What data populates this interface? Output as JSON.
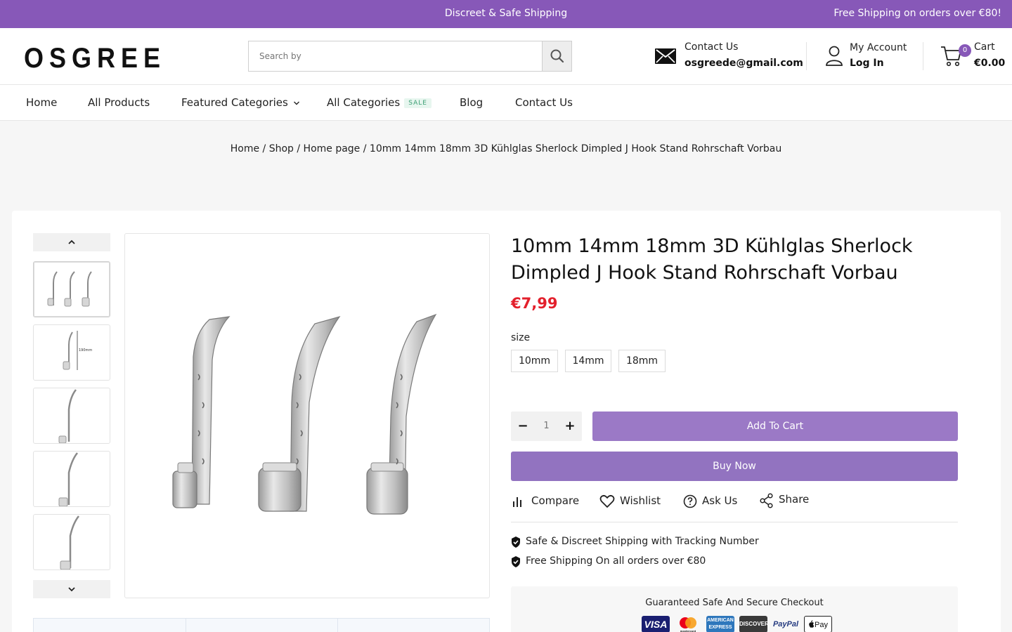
{
  "topbar": {
    "center_text": "Discreet & Safe Shipping",
    "right_text": "Free Shipping on orders over €80!"
  },
  "header": {
    "logo": "OSGREE",
    "search_placeholder": "Search by",
    "contact_label": "Contact Us",
    "contact_email": "osgreede@gmail.com",
    "account_label": "My Account",
    "account_action": "Log In",
    "cart_label": "Cart",
    "cart_total": "€0.00",
    "cart_count": "0"
  },
  "nav": {
    "home": "Home",
    "all_products": "All Products",
    "featured_categories": "Featured Categories",
    "all_categories": "All Categories",
    "sale_badge": "SALE",
    "blog": "Blog",
    "contact_us": "Contact Us"
  },
  "breadcrumb": "Home / Shop / Home page / 10mm 14mm 18mm 3D Kühlglas Sherlock Dimpled J Hook Stand Rohrschaft Vorbau",
  "product": {
    "title": "10mm 14mm 18mm 3D Kühlglas Sherlock Dimpled J Hook Stand Rohrschaft Vorbau",
    "price": "€7,99",
    "size_label": "size",
    "sizes": [
      "10mm",
      "14mm",
      "18mm"
    ],
    "quantity": "1",
    "qty_minus": "−",
    "qty_plus": "+",
    "add_to_cart": "Add To Cart",
    "buy_now": "Buy Now"
  },
  "actions": {
    "compare": "Compare",
    "wishlist": "Wishlist",
    "ask_us": "Ask Us",
    "share": "Share"
  },
  "features": [
    "Safe & Discreet Shipping with Tracking Number",
    "Free Shipping On all orders over €80"
  ],
  "checkout": {
    "title": "Guaranteed Safe And Secure Checkout",
    "payment_methods": [
      "VISA",
      "mastercard",
      "AMERICAN EXPRESS",
      "DISCOVER",
      "PayPal",
      "Pay"
    ]
  },
  "colors": {
    "brand": "#8758b8",
    "button": "#9b79c6",
    "price": "#e3202c"
  }
}
